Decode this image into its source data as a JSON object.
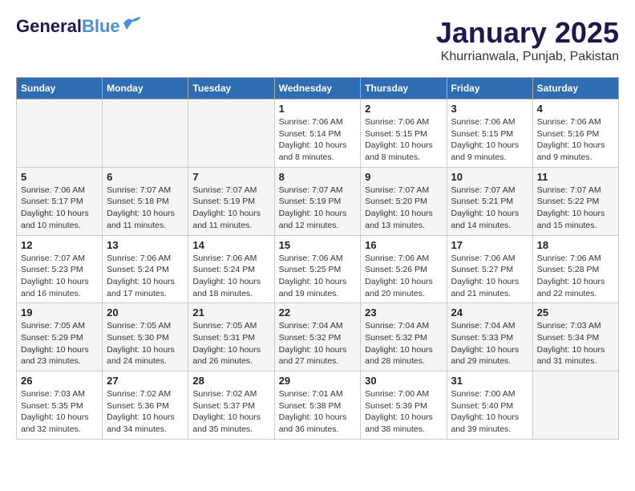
{
  "header": {
    "logo_general": "General",
    "logo_blue": "Blue",
    "month_title": "January 2025",
    "subtitle": "Khurrianwala, Punjab, Pakistan"
  },
  "days_of_week": [
    "Sunday",
    "Monday",
    "Tuesday",
    "Wednesday",
    "Thursday",
    "Friday",
    "Saturday"
  ],
  "weeks": [
    [
      {
        "day": "",
        "info": ""
      },
      {
        "day": "",
        "info": ""
      },
      {
        "day": "",
        "info": ""
      },
      {
        "day": "1",
        "info": "Sunrise: 7:06 AM\nSunset: 5:14 PM\nDaylight: 10 hours\nand 8 minutes."
      },
      {
        "day": "2",
        "info": "Sunrise: 7:06 AM\nSunset: 5:15 PM\nDaylight: 10 hours\nand 8 minutes."
      },
      {
        "day": "3",
        "info": "Sunrise: 7:06 AM\nSunset: 5:15 PM\nDaylight: 10 hours\nand 9 minutes."
      },
      {
        "day": "4",
        "info": "Sunrise: 7:06 AM\nSunset: 5:16 PM\nDaylight: 10 hours\nand 9 minutes."
      }
    ],
    [
      {
        "day": "5",
        "info": "Sunrise: 7:06 AM\nSunset: 5:17 PM\nDaylight: 10 hours\nand 10 minutes."
      },
      {
        "day": "6",
        "info": "Sunrise: 7:07 AM\nSunset: 5:18 PM\nDaylight: 10 hours\nand 11 minutes."
      },
      {
        "day": "7",
        "info": "Sunrise: 7:07 AM\nSunset: 5:19 PM\nDaylight: 10 hours\nand 11 minutes."
      },
      {
        "day": "8",
        "info": "Sunrise: 7:07 AM\nSunset: 5:19 PM\nDaylight: 10 hours\nand 12 minutes."
      },
      {
        "day": "9",
        "info": "Sunrise: 7:07 AM\nSunset: 5:20 PM\nDaylight: 10 hours\nand 13 minutes."
      },
      {
        "day": "10",
        "info": "Sunrise: 7:07 AM\nSunset: 5:21 PM\nDaylight: 10 hours\nand 14 minutes."
      },
      {
        "day": "11",
        "info": "Sunrise: 7:07 AM\nSunset: 5:22 PM\nDaylight: 10 hours\nand 15 minutes."
      }
    ],
    [
      {
        "day": "12",
        "info": "Sunrise: 7:07 AM\nSunset: 5:23 PM\nDaylight: 10 hours\nand 16 minutes."
      },
      {
        "day": "13",
        "info": "Sunrise: 7:06 AM\nSunset: 5:24 PM\nDaylight: 10 hours\nand 17 minutes."
      },
      {
        "day": "14",
        "info": "Sunrise: 7:06 AM\nSunset: 5:24 PM\nDaylight: 10 hours\nand 18 minutes."
      },
      {
        "day": "15",
        "info": "Sunrise: 7:06 AM\nSunset: 5:25 PM\nDaylight: 10 hours\nand 19 minutes."
      },
      {
        "day": "16",
        "info": "Sunrise: 7:06 AM\nSunset: 5:26 PM\nDaylight: 10 hours\nand 20 minutes."
      },
      {
        "day": "17",
        "info": "Sunrise: 7:06 AM\nSunset: 5:27 PM\nDaylight: 10 hours\nand 21 minutes."
      },
      {
        "day": "18",
        "info": "Sunrise: 7:06 AM\nSunset: 5:28 PM\nDaylight: 10 hours\nand 22 minutes."
      }
    ],
    [
      {
        "day": "19",
        "info": "Sunrise: 7:05 AM\nSunset: 5:29 PM\nDaylight: 10 hours\nand 23 minutes."
      },
      {
        "day": "20",
        "info": "Sunrise: 7:05 AM\nSunset: 5:30 PM\nDaylight: 10 hours\nand 24 minutes."
      },
      {
        "day": "21",
        "info": "Sunrise: 7:05 AM\nSunset: 5:31 PM\nDaylight: 10 hours\nand 26 minutes."
      },
      {
        "day": "22",
        "info": "Sunrise: 7:04 AM\nSunset: 5:32 PM\nDaylight: 10 hours\nand 27 minutes."
      },
      {
        "day": "23",
        "info": "Sunrise: 7:04 AM\nSunset: 5:32 PM\nDaylight: 10 hours\nand 28 minutes."
      },
      {
        "day": "24",
        "info": "Sunrise: 7:04 AM\nSunset: 5:33 PM\nDaylight: 10 hours\nand 29 minutes."
      },
      {
        "day": "25",
        "info": "Sunrise: 7:03 AM\nSunset: 5:34 PM\nDaylight: 10 hours\nand 31 minutes."
      }
    ],
    [
      {
        "day": "26",
        "info": "Sunrise: 7:03 AM\nSunset: 5:35 PM\nDaylight: 10 hours\nand 32 minutes."
      },
      {
        "day": "27",
        "info": "Sunrise: 7:02 AM\nSunset: 5:36 PM\nDaylight: 10 hours\nand 34 minutes."
      },
      {
        "day": "28",
        "info": "Sunrise: 7:02 AM\nSunset: 5:37 PM\nDaylight: 10 hours\nand 35 minutes."
      },
      {
        "day": "29",
        "info": "Sunrise: 7:01 AM\nSunset: 5:38 PM\nDaylight: 10 hours\nand 36 minutes."
      },
      {
        "day": "30",
        "info": "Sunrise: 7:00 AM\nSunset: 5:39 PM\nDaylight: 10 hours\nand 38 minutes."
      },
      {
        "day": "31",
        "info": "Sunrise: 7:00 AM\nSunset: 5:40 PM\nDaylight: 10 hours\nand 39 minutes."
      },
      {
        "day": "",
        "info": ""
      }
    ]
  ]
}
